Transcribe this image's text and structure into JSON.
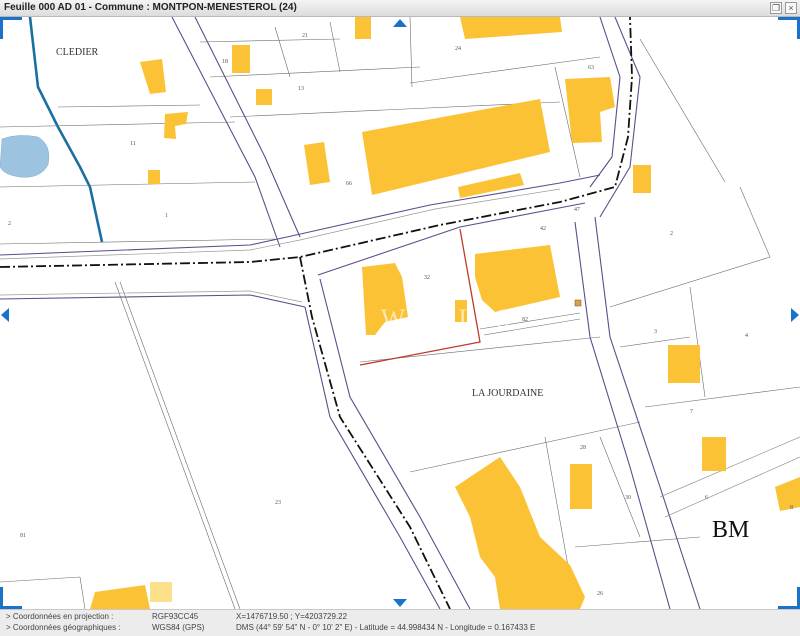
{
  "window": {
    "title": "Feuille 000 AD 01 - Commune : MONTPON-MENESTEROL (24)"
  },
  "map": {
    "places": {
      "cledier": "CLEDIER",
      "la_jourdaine": "LA JOURDAINE",
      "bm": "BM",
      "watermark": "D W I L S"
    },
    "parcels": {
      "p24": "24",
      "p63": "63",
      "p13": "13",
      "p18": "18",
      "p21": "21",
      "p11": "11",
      "p2a": "2",
      "p1": "1",
      "p66": "66",
      "p42": "42",
      "p32": "32",
      "p82": "82",
      "p47": "47",
      "p2b": "2",
      "p3": "3",
      "p4": "4",
      "p7": "7",
      "p28": "28",
      "p30": "30",
      "p6": "6",
      "p23": "23",
      "p81": "81",
      "p26": "26",
      "p8": "8"
    }
  },
  "status": {
    "proj_label": "> Coordonnées en projection :",
    "proj_system": "RGF93CC45",
    "proj_value": "X=1476719.50 ; Y=4203729.22",
    "geo_label": "> Coordonnées géographiques :",
    "geo_system": "WGS84 (GPS)",
    "geo_value": "DMS (44° 59' 54\" N - 0° 10' 2\" E) - Latitude = 44.998434 N - Longitude = 0.167433 E"
  },
  "colors": {
    "building": "#fcc236",
    "road_edge": "#5a4f8a",
    "water": "#1a6fa0",
    "pond": "#9cc4e0",
    "frame": "#1a73c9",
    "selection": "#c0392b"
  }
}
